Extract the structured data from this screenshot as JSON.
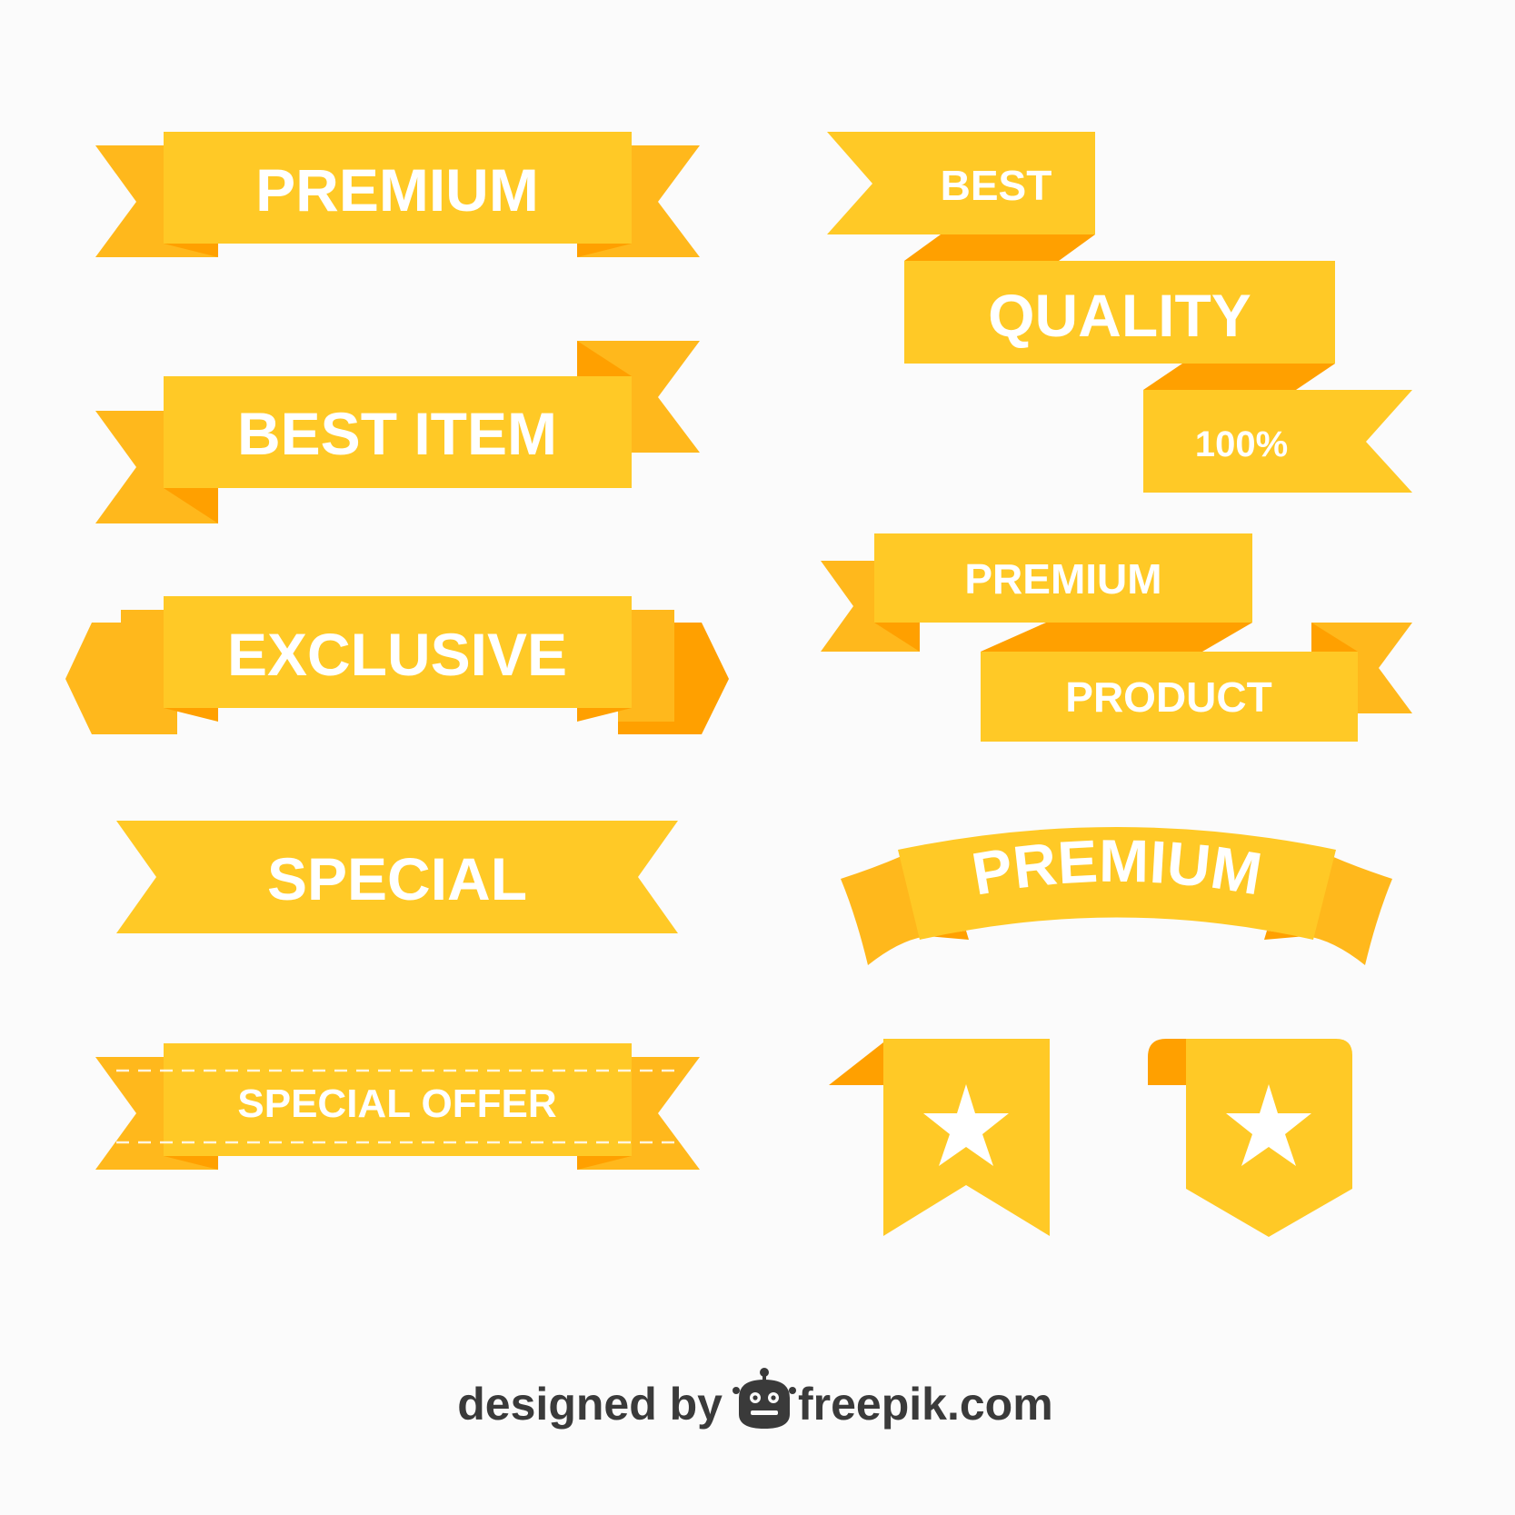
{
  "colors": {
    "background": "#fbfbfb",
    "ribbon_main": "#ffc926",
    "ribbon_end": "#ffb81c",
    "ribbon_fold": "#ffa000",
    "ribbon_text": "#ffffff",
    "credit_text": "#3a3a3a"
  },
  "ribbons": {
    "premium_1": "PREMIUM",
    "best_item": "BEST ITEM",
    "exclusive": "EXCLUSIVE",
    "special": "SPECIAL",
    "special_offer": "SPECIAL OFFER",
    "best": "BEST",
    "quality": "QUALITY",
    "percent": "100%",
    "premium_2": "PREMIUM",
    "product": "PRODUCT",
    "premium_arc": "PREMIUM"
  },
  "bookmarks": [
    {
      "icon": "star-icon"
    },
    {
      "icon": "star-icon"
    }
  ],
  "credit": {
    "designed_by": "designed by",
    "brand": "freepik.com",
    "logo_icon": "freepik-logo-icon"
  }
}
